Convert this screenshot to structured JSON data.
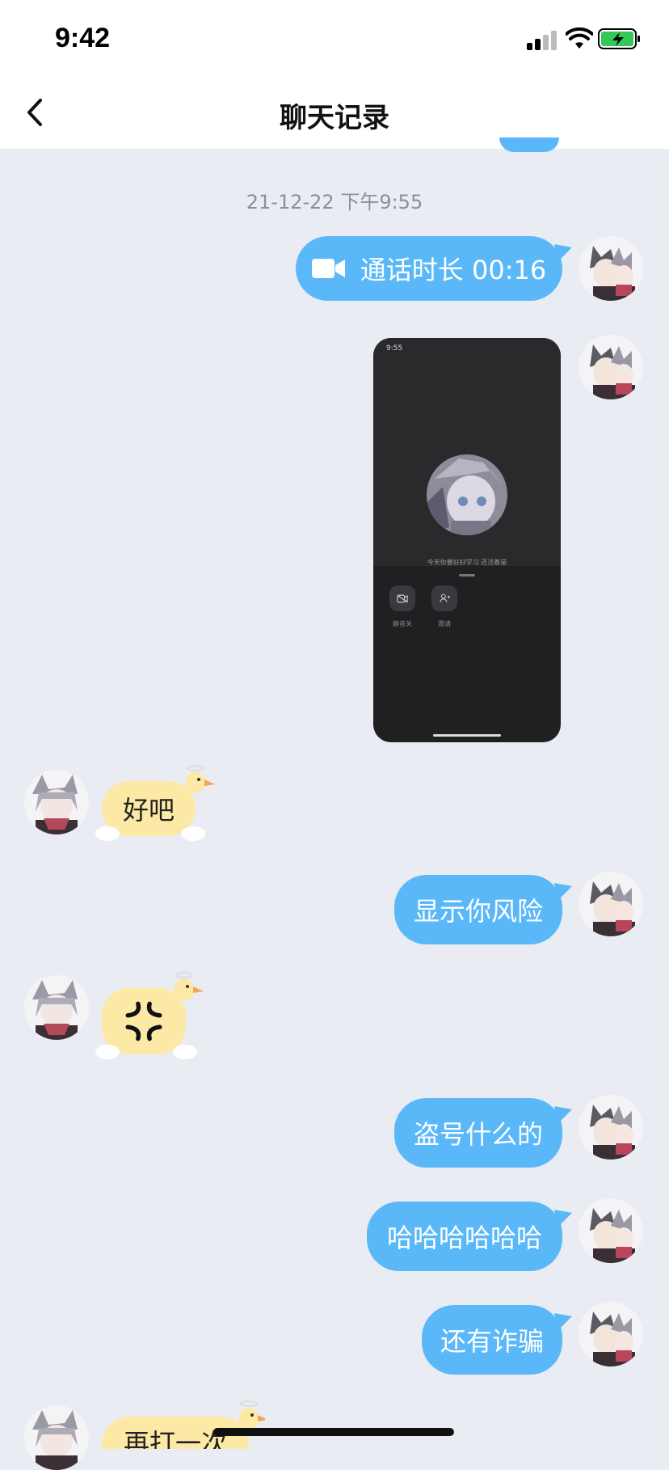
{
  "status_bar": {
    "time": "9:42"
  },
  "header": {
    "title": "聊天记录"
  },
  "chat": {
    "timestamp": "21-12-22 下午9:55",
    "call_message": "通话时长 00:16",
    "screenshot": {
      "time": "9:55",
      "caption": "今天你要好好学习 还活着是",
      "btn1": "静音关",
      "btn2": "邀请"
    },
    "messages": [
      {
        "side": "in",
        "text": "好吧"
      },
      {
        "side": "out",
        "text": "显示你风险"
      },
      {
        "side": "in",
        "sticker": "anger-icon"
      },
      {
        "side": "out",
        "text": "盗号什么的"
      },
      {
        "side": "out",
        "text": "哈哈哈哈哈哈"
      },
      {
        "side": "out",
        "text": "还有诈骗"
      },
      {
        "side": "in",
        "text": "再打一次"
      }
    ]
  },
  "colors": {
    "bubble_out": "#5ab8f9",
    "bubble_in": "#fde9a6",
    "background": "#eaecf3"
  }
}
